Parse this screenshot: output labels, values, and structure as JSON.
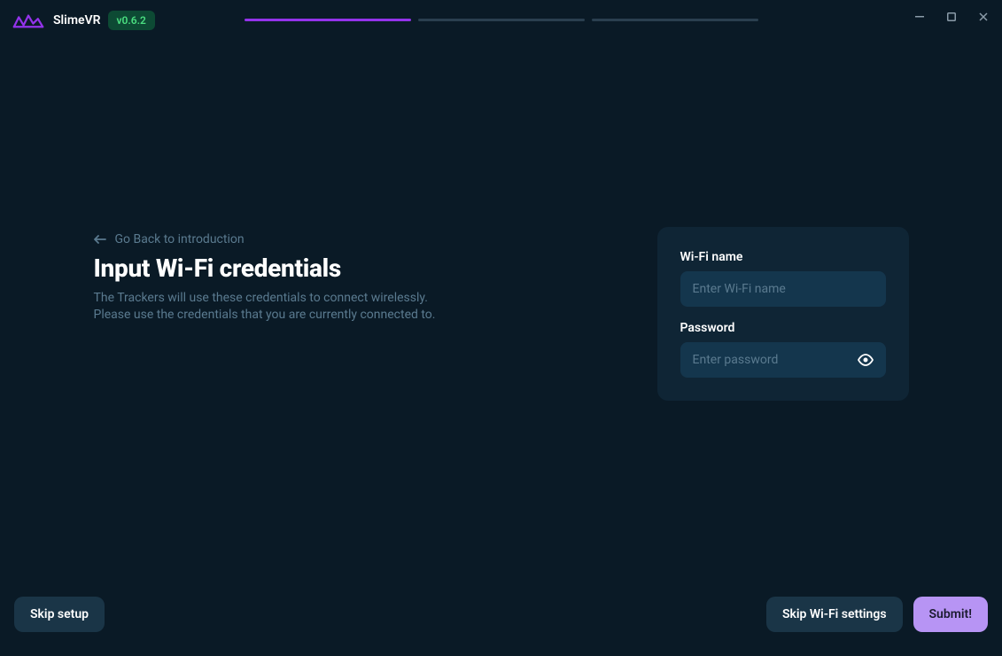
{
  "app": {
    "name": "SlimeVR",
    "version": "v0.6.2"
  },
  "back": {
    "label": "Go Back to introduction"
  },
  "page": {
    "title": "Input Wi-Fi credentials",
    "description_line1": "The Trackers will use these credentials to connect wirelessly.",
    "description_line2": "Please use the credentials that you are currently connected to."
  },
  "form": {
    "wifi_label": "Wi-Fi name",
    "wifi_placeholder": "Enter Wi-Fi name",
    "password_label": "Password",
    "password_placeholder": "Enter password"
  },
  "footer": {
    "skip_setup": "Skip setup",
    "skip_wifi": "Skip Wi-Fi settings",
    "submit": "Submit!"
  }
}
